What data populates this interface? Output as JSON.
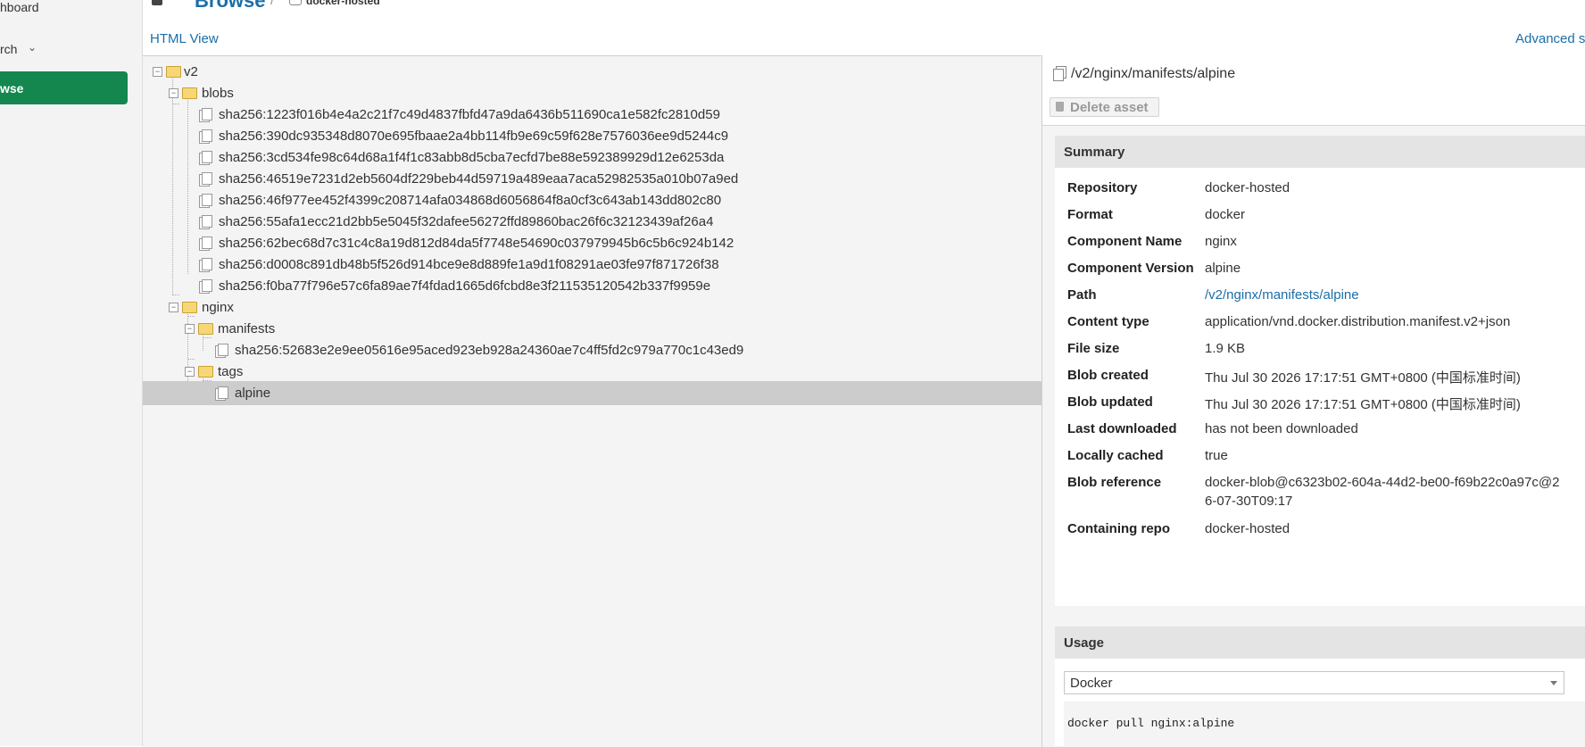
{
  "sidebar": {
    "dashboard": "hboard",
    "search": "rch",
    "search_chevron": "⌄",
    "browse": "wse"
  },
  "header": {
    "breadcrumb_title": "Browse",
    "breadcrumb_sep": "/",
    "breadcrumb_repo": "docker-hosted",
    "html_view": "HTML View",
    "advanced": "Advanced s"
  },
  "tree": {
    "root": "v2",
    "blobs_folder": "blobs",
    "blobs": [
      "sha256:1223f016b4e4a2c21f7c49d4837fbfd47a9da6436b511690ca1e582fc2810d59",
      "sha256:390dc935348d8070e695fbaae2a4bb114fb9e69c59f628e7576036ee9d5244c9",
      "sha256:3cd534fe98c64d68a1f4f1c83abb8d5cba7ecfd7be88e592389929d12e6253da",
      "sha256:46519e7231d2eb5604df229beb44d59719a489eaa7aca52982535a010b07a9ed",
      "sha256:46f977ee452f4399c208714afa034868d6056864f8a0cf3c643ab143dd802c80",
      "sha256:55afa1ecc21d2bb5e5045f32dafee56272ffd89860bac26f6c32123439af26a4",
      "sha256:62bec68d7c31c4c8a19d812d84da5f7748e54690c037979945b6c5b6c924b142",
      "sha256:d0008c891db48b5f526d914bce9e8d889fe1a9d1f08291ae03fe97f871726f38",
      "sha256:f0ba77f796e57c6fa89ae7f4fdad1665d6fcbd8e3f211535120542b337f9959e"
    ],
    "nginx_folder": "nginx",
    "manifests_folder": "manifests",
    "manifest_item": "sha256:52683e2e9ee05616e95aced923eb928a24360ae7c4ff5fd2c979a770c1c43ed9",
    "tags_folder": "tags",
    "tag_item": "alpine"
  },
  "details": {
    "asset_path": "/v2/nginx/manifests/alpine",
    "delete_label": "Delete asset",
    "summary_title": "Summary",
    "summary": [
      {
        "key": "Repository",
        "value": "docker-hosted"
      },
      {
        "key": "Format",
        "value": "docker"
      },
      {
        "key": "Component Name",
        "value": "nginx"
      },
      {
        "key": "Component Version",
        "value": "alpine"
      },
      {
        "key": "Path",
        "value": "/v2/nginx/manifests/alpine"
      },
      {
        "key": "Content type",
        "value": "application/vnd.docker.distribution.manifest.v2+json"
      },
      {
        "key": "File size",
        "value": "1.9 KB"
      },
      {
        "key": "Blob created",
        "value": "Thu Jul 30 2026 17:17:51 GMT+0800 (中国标准时间)"
      },
      {
        "key": "Blob updated",
        "value": "Thu Jul 30 2026 17:17:51 GMT+0800 (中国标准时间)"
      },
      {
        "key": "Last downloaded",
        "value": "has not been downloaded"
      },
      {
        "key": "Locally cached",
        "value": "true"
      },
      {
        "key": "Blob reference",
        "value": "docker-blob@c6323b02-604a-44d2-be00-f69b22c0a97c@2",
        "value2": "6-07-30T09:17"
      },
      {
        "key": "Containing repo",
        "value": "docker-hosted"
      }
    ],
    "usage_title": "Usage",
    "usage_select": "Docker",
    "usage_command": "docker pull nginx:alpine"
  },
  "colors": {
    "accent_green": "#14874f",
    "link_blue": "#1b6ea8",
    "selected_row": "#cccccc"
  }
}
